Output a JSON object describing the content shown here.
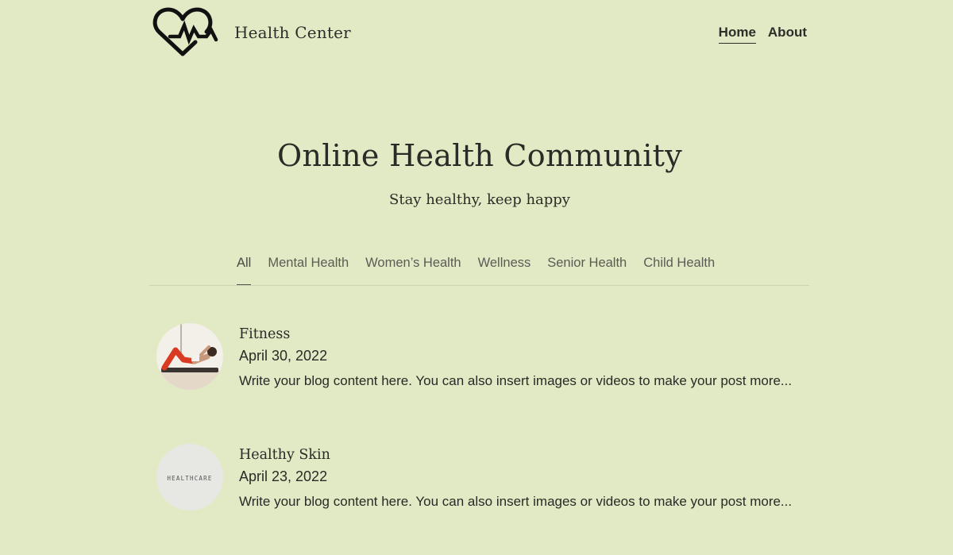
{
  "header": {
    "site_title": "Health Center",
    "logo_icon": "heartbeat-icon",
    "nav": [
      {
        "label": "Home",
        "active": true
      },
      {
        "label": "About",
        "active": false
      }
    ]
  },
  "hero": {
    "title": "Online Health Community",
    "subtitle": "Stay healthy, keep happy"
  },
  "categories": {
    "items": [
      "All",
      "Mental Health",
      "Women’s Health",
      "Wellness",
      "Senior Health",
      "Child Health"
    ],
    "active": "All"
  },
  "posts": [
    {
      "title": "Fitness",
      "date": "April 30, 2022",
      "excerpt": "Write your blog content here. You can also insert images or videos to make your post more...",
      "thumbnail": "fitness-photo"
    },
    {
      "title": "Healthy Skin",
      "date": "April 23, 2022",
      "excerpt": "Write your blog content here. You can also insert images or videos to make your post more...",
      "thumbnail": "healthcare-photo",
      "thumbnail_text": "HEALTHCARE"
    }
  ],
  "colors": {
    "background": "#e2eac5",
    "text": "#2a2a26",
    "muted": "#5b5b55"
  }
}
